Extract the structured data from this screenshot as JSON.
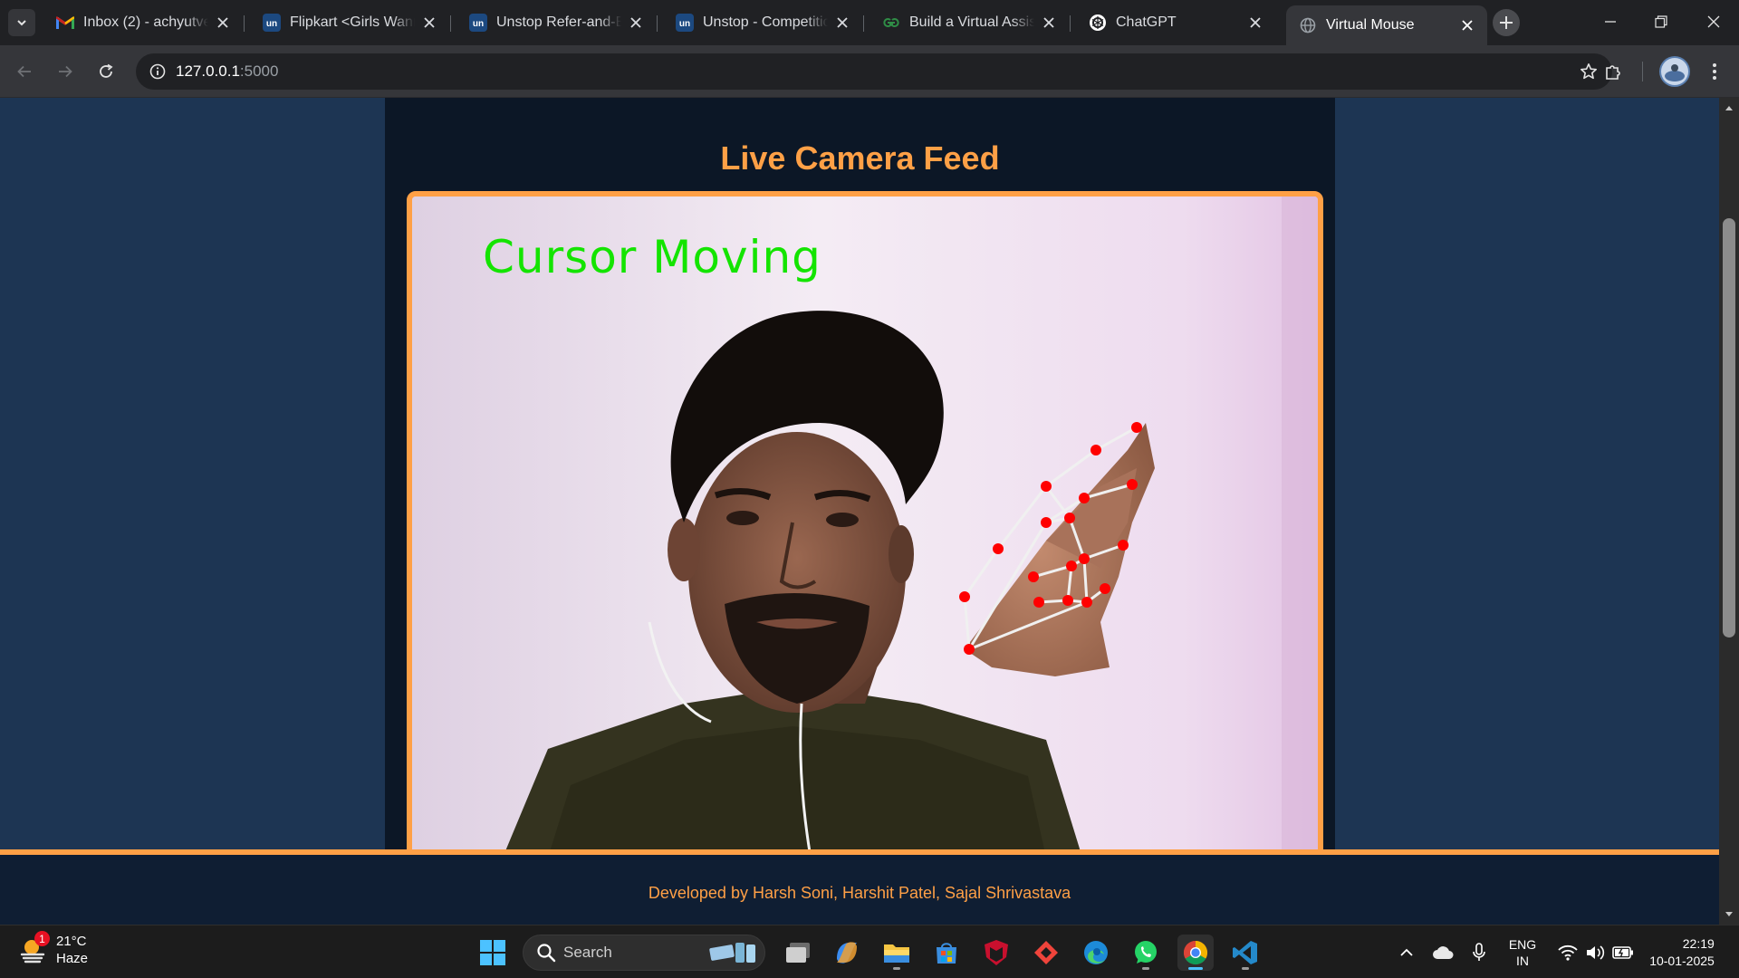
{
  "browser": {
    "tabs": [
      {
        "title": "Inbox (2) - achyutvee",
        "icon": "gmail-icon",
        "active": false
      },
      {
        "title": "Flipkart <Girls Wanna",
        "icon": "unstop-icon",
        "active": false
      },
      {
        "title": "Unstop Refer-and-Ea",
        "icon": "unstop-icon",
        "active": false
      },
      {
        "title": "Unstop - Competitio",
        "icon": "unstop-icon",
        "active": false
      },
      {
        "title": "Build a Virtual Assista",
        "icon": "geeksforgeeks-icon",
        "active": false
      },
      {
        "title": "ChatGPT",
        "icon": "chatgpt-icon",
        "active": false
      },
      {
        "title": "Virtual Mouse",
        "icon": "globe-icon",
        "active": true
      }
    ],
    "url_host": "127.0.0.1",
    "url_port": ":5000"
  },
  "page": {
    "feed_title": "Live Camera Feed",
    "overlay_text": "Cursor Moving",
    "footer_text": "Developed by Harsh Soni, Harshit Patel, Sajal Shrivastava"
  },
  "taskbar": {
    "weather_temp": "21°C",
    "weather_desc": "Haze",
    "weather_badge": "1",
    "search_label": "Search",
    "lang_top": "ENG",
    "lang_bottom": "IN",
    "time": "22:19",
    "date": "10-01-2025"
  },
  "colors": {
    "accent_orange": "#ffa046",
    "page_background": "#1d3553",
    "panel_background": "#0c1726",
    "overlay_green": "#14e400",
    "landmark_red": "#ff0000"
  }
}
